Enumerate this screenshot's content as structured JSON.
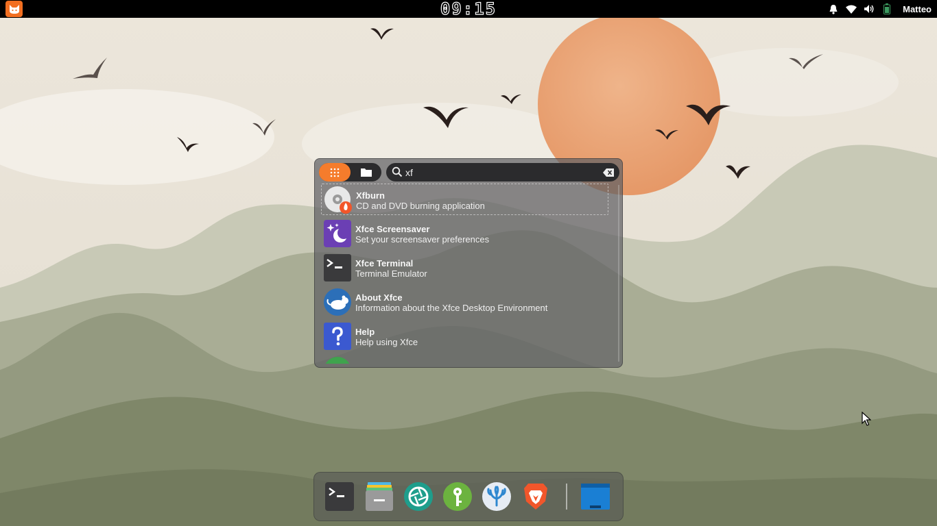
{
  "panel": {
    "clock": "09:15",
    "user": "Matteo",
    "tray_icons": [
      "bell-icon",
      "wifi-icon",
      "volume-icon",
      "battery-icon"
    ]
  },
  "launcher": {
    "modes": [
      "apps-grid-icon",
      "folder-icon"
    ],
    "search": {
      "value": "xf"
    },
    "results": [
      {
        "name": "Xfburn",
        "desc": "CD and DVD burning application",
        "icon": "disc-burn-icon",
        "selected": true
      },
      {
        "name": "Xfce Screensaver",
        "desc": "Set your screensaver preferences",
        "icon": "screensaver-icon"
      },
      {
        "name": "Xfce Terminal",
        "desc": "Terminal Emulator",
        "icon": "terminal-icon"
      },
      {
        "name": "About Xfce",
        "desc": "Information about the Xfce Desktop Environment",
        "icon": "xfce-mouse-icon"
      },
      {
        "name": "Help",
        "desc": "Help using Xfce",
        "icon": "help-icon"
      },
      {
        "name": "",
        "desc": "",
        "icon": "partial-green-icon"
      }
    ]
  },
  "dock": {
    "items": [
      "terminal-icon",
      "file-manager-icon",
      "screenshot-aperture-icon",
      "password-key-icon",
      "vscodium-icon",
      "brave-browser-icon",
      "window-icon"
    ]
  },
  "colors": {
    "accent": "#f57c2c",
    "panel_bg": "#000000",
    "sun": "#e9a273",
    "hills": "#8b937a"
  }
}
